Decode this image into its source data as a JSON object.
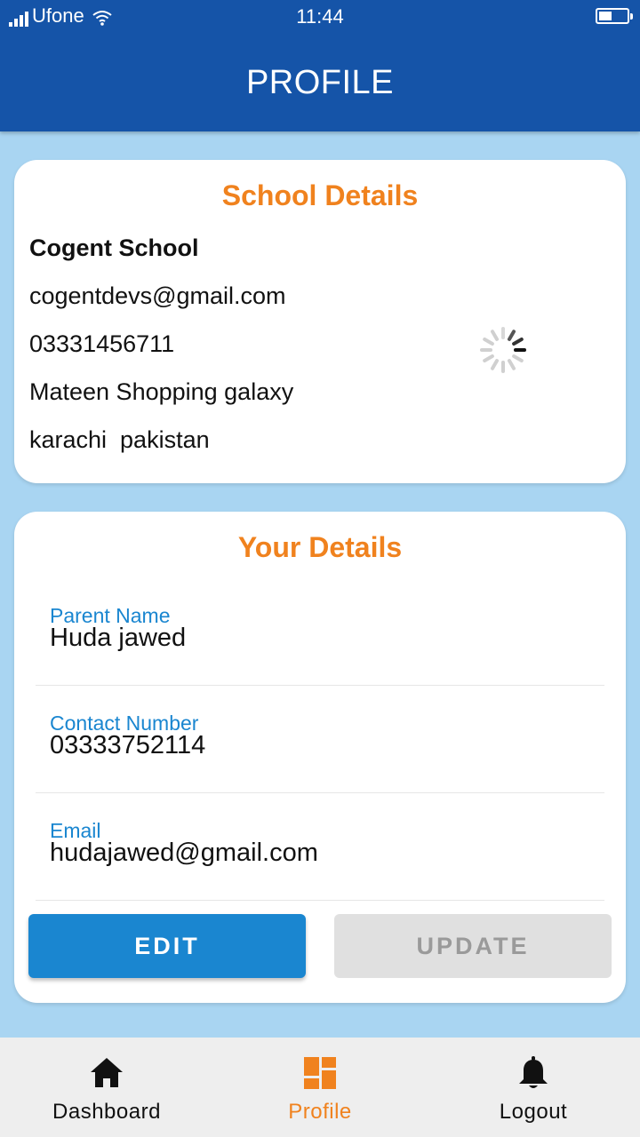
{
  "status_bar": {
    "carrier": "Ufone",
    "time": "11:44"
  },
  "header": {
    "title": "PROFILE"
  },
  "school_details": {
    "title": "School Details",
    "name": "Cogent School",
    "email": "cogentdevs@gmail.com",
    "phone": "03331456711",
    "address": "Mateen Shopping galaxy",
    "city_country": "karachi  pakistan"
  },
  "your_details": {
    "title": "Your Details",
    "fields": [
      {
        "label": "Parent Name",
        "value": "Huda jawed"
      },
      {
        "label": "Contact Number",
        "value": "03333752114"
      },
      {
        "label": "Email",
        "value": "hudajawed@gmail.com"
      }
    ],
    "edit_label": "EDIT",
    "update_label": "UPDATE"
  },
  "bottom_nav": {
    "items": [
      {
        "label": "Dashboard",
        "icon": "home-icon"
      },
      {
        "label": "Profile",
        "icon": "dashboard-grid-icon",
        "active": true
      },
      {
        "label": "Logout",
        "icon": "bell-icon"
      }
    ]
  },
  "colors": {
    "header_bg": "#1554a8",
    "page_bg": "#a9d5f2",
    "accent_orange": "#f0821e",
    "primary_blue": "#1a86d0",
    "disabled_gray": "#e0e0e0"
  }
}
